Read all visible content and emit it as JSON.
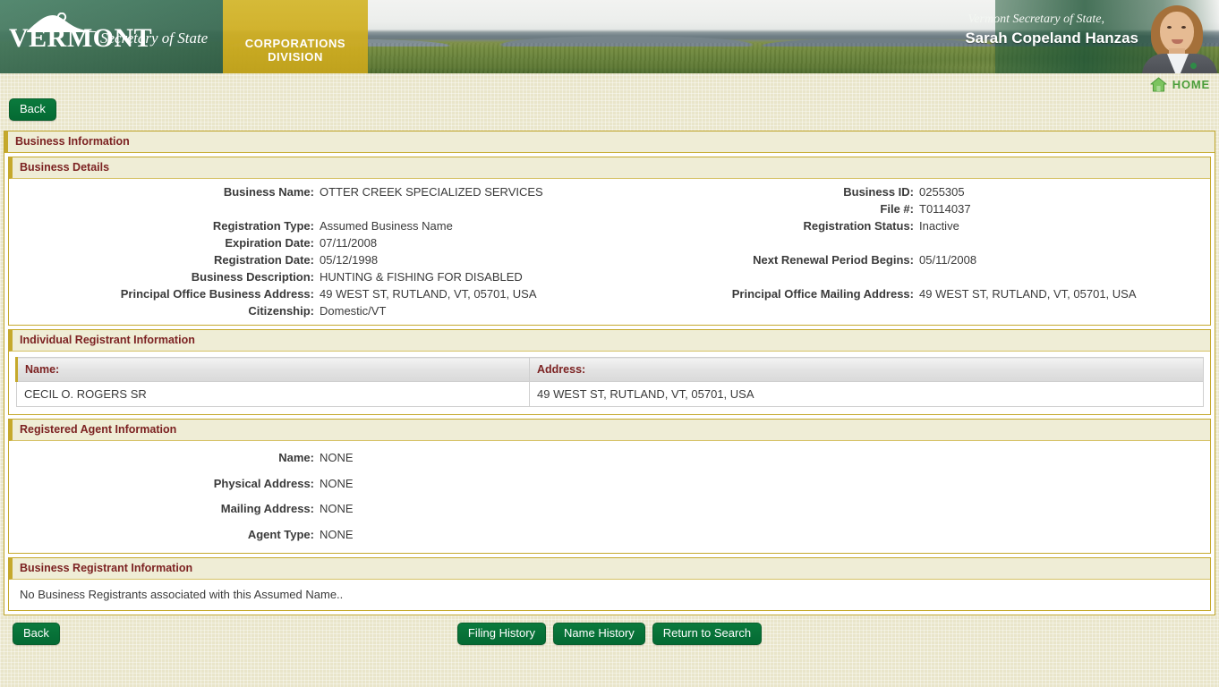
{
  "banner": {
    "state_name": "VERMONT",
    "tagline": "Secretary of State",
    "division": "CORPORATIONS  DIVISION",
    "sos_prefix": "Vermont Secretary of State,",
    "sos_name": "Sarah Copeland Hanzas",
    "mountain_icon": "mountain-logo-icon",
    "portrait_icon": "secretary-portrait"
  },
  "home": {
    "label": "HOME",
    "icon": "home-house-icon",
    "accent_color": "#4b9e3a"
  },
  "toolbar": {
    "back_label": "Back"
  },
  "colors": {
    "page_background": "#e9e5ca",
    "panel_header": "#efedd6",
    "panel_border": "#c5a92c",
    "section_title_text": "#7c2222",
    "button_green": "#0b7a3d",
    "banner_green": "#3f7a5e",
    "banner_gold": "#cfae22"
  },
  "business_information": {
    "title": "Business Information",
    "business_details": {
      "title": "Business Details",
      "left_fields": [
        {
          "label": "Business Name:",
          "value": "OTTER CREEK SPECIALIZED SERVICES"
        },
        {
          "label": "",
          "value": ""
        },
        {
          "label": "Registration Type:",
          "value": "Assumed Business Name"
        },
        {
          "label": "Expiration Date:",
          "value": "07/11/2008"
        },
        {
          "label": "Registration Date:",
          "value": "05/12/1998"
        },
        {
          "label": "Business Description:",
          "value": "HUNTING & FISHING FOR DISABLED"
        },
        {
          "label": "Principal Office Business Address:",
          "value": "49 WEST ST, RUTLAND, VT, 05701, USA"
        },
        {
          "label": "Citizenship:",
          "value": "Domestic/VT"
        }
      ],
      "right_fields": [
        {
          "label": "Business ID:",
          "value": "0255305"
        },
        {
          "label": "File #:",
          "value": "T0114037"
        },
        {
          "label": "Registration Status:",
          "value": "Inactive"
        },
        {
          "label": "",
          "value": ""
        },
        {
          "label": "Next Renewal Period Begins:",
          "value": "05/11/2008"
        },
        {
          "label": "",
          "value": ""
        },
        {
          "label": "Principal Office Mailing Address:",
          "value": "49 WEST ST, RUTLAND, VT, 05701, USA"
        },
        {
          "label": "",
          "value": ""
        }
      ]
    },
    "individual_registrant": {
      "title": "Individual Registrant Information",
      "columns": [
        "Name:",
        "Address:"
      ],
      "rows": [
        {
          "name": "CECIL O. ROGERS SR",
          "address": "49 WEST ST, RUTLAND, VT, 05701, USA"
        }
      ]
    },
    "registered_agent": {
      "title": "Registered Agent Information",
      "fields": [
        {
          "label": "Name:",
          "value": "NONE"
        },
        {
          "label": "Physical Address:",
          "value": "NONE"
        },
        {
          "label": "Mailing Address:",
          "value": "NONE"
        },
        {
          "label": "Agent Type:",
          "value": "NONE"
        }
      ]
    },
    "business_registrant": {
      "title": "Business Registrant Information",
      "empty_message": "No Business Registrants associated with this Assumed Name.."
    }
  },
  "footer": {
    "back_label": "Back",
    "filing_history_label": "Filing History",
    "name_history_label": "Name History",
    "return_to_search_label": "Return to Search"
  }
}
